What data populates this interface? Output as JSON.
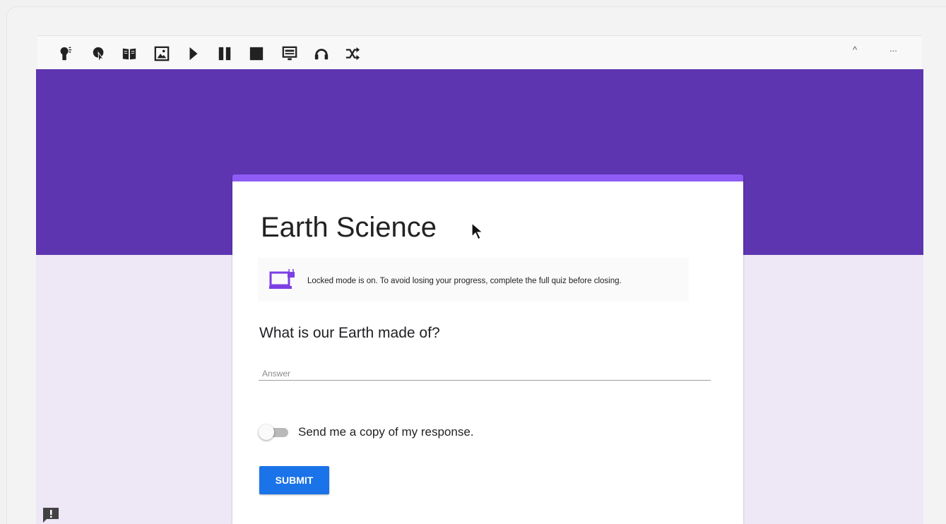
{
  "toolbar": {
    "icons": [
      "speaker-icon",
      "speak-pointer-icon",
      "dictionary-icon",
      "picture-dictionary-icon",
      "play-icon",
      "pause-icon",
      "stop-icon",
      "screen-mask-icon",
      "voice-note-icon",
      "shuffle-icon"
    ],
    "collapse_label": "^",
    "more_label": "..."
  },
  "colors": {
    "header": "#5e35b1",
    "background": "#ede7f6",
    "accent_top": "#8e5cf5",
    "submit": "#1a73e8"
  },
  "form": {
    "title": "Earth Science",
    "locked_message": "Locked mode is on. To avoid losing your progress, complete the full quiz before closing.",
    "question": "What is our Earth made of?",
    "answer_placeholder": "Answer",
    "copy_label": "Send me a copy of my response.",
    "copy_enabled": false,
    "submit_label": "SUBMIT"
  }
}
